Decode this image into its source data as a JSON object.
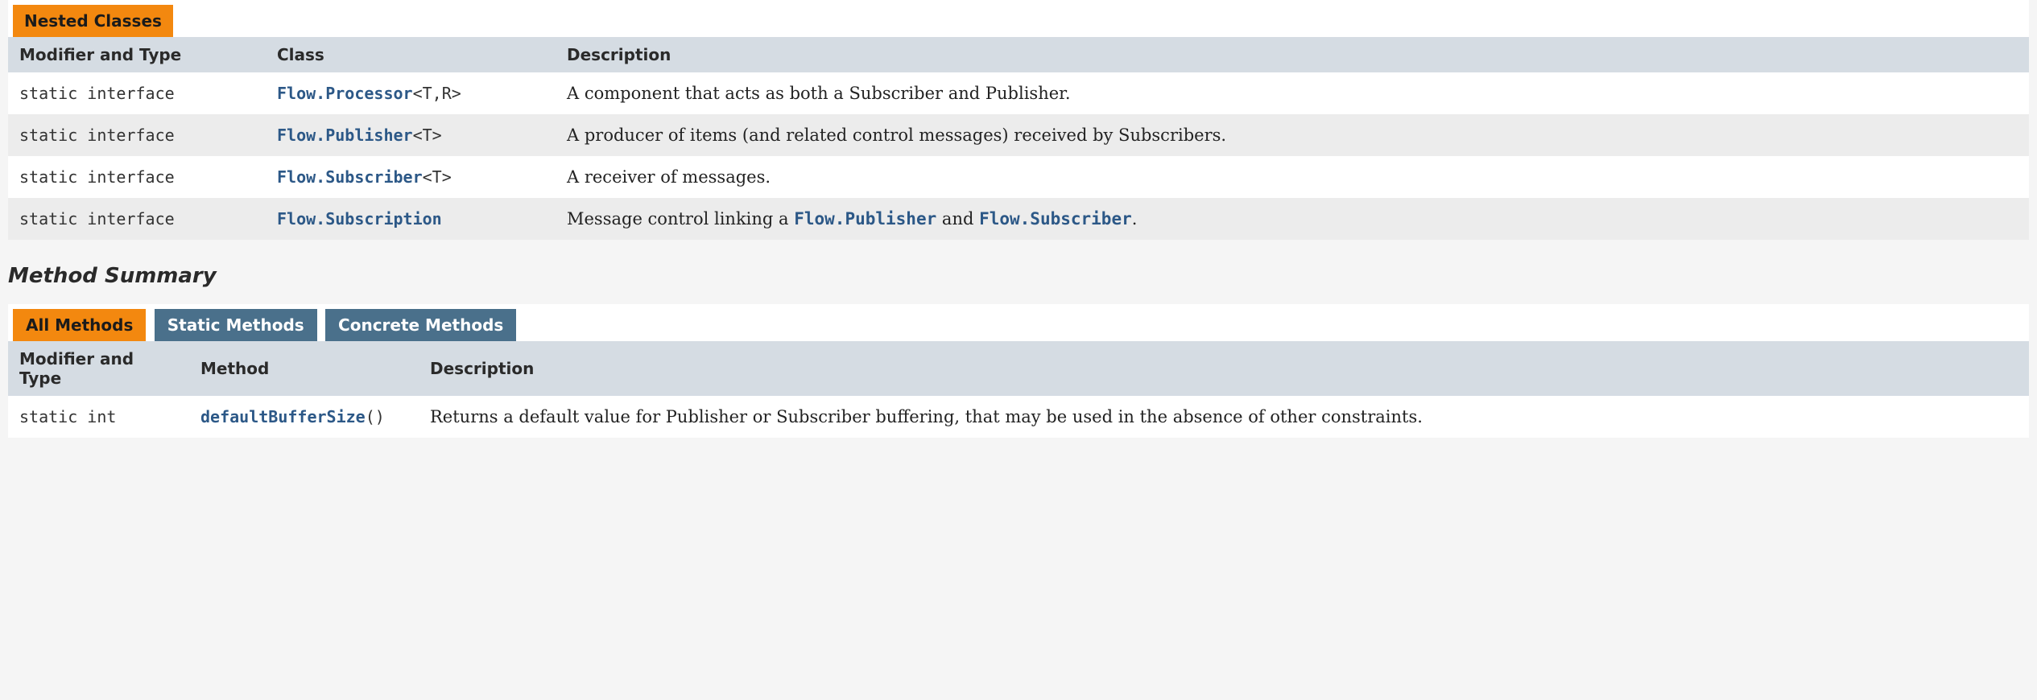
{
  "nested": {
    "caption": "Nested Classes",
    "headers": {
      "modifier": "Modifier and Type",
      "class": "Class",
      "description": "Description"
    },
    "rows": [
      {
        "modifier": "static interface ",
        "class_link": "Flow.Processor",
        "class_generic": "<T,R>",
        "desc_pre": "A component that acts as both a Subscriber and Publisher.",
        "desc_ref1": "",
        "desc_mid": "",
        "desc_ref2": "",
        "desc_post": ""
      },
      {
        "modifier": "static interface ",
        "class_link": "Flow.Publisher",
        "class_generic": "<T>",
        "desc_pre": "A producer of items (and related control messages) received by Subscribers.",
        "desc_ref1": "",
        "desc_mid": "",
        "desc_ref2": "",
        "desc_post": ""
      },
      {
        "modifier": "static interface ",
        "class_link": "Flow.Subscriber",
        "class_generic": "<T>",
        "desc_pre": "A receiver of messages.",
        "desc_ref1": "",
        "desc_mid": "",
        "desc_ref2": "",
        "desc_post": ""
      },
      {
        "modifier": "static interface ",
        "class_link": "Flow.Subscription",
        "class_generic": "",
        "desc_pre": "Message control linking a ",
        "desc_ref1": "Flow.Publisher",
        "desc_mid": " and ",
        "desc_ref2": "Flow.Subscriber",
        "desc_post": "."
      }
    ]
  },
  "methods": {
    "title": "Method Summary",
    "tabs": {
      "all": "All Methods",
      "static": "Static Methods",
      "concrete": "Concrete Methods"
    },
    "headers": {
      "modifier": "Modifier and Type",
      "method": "Method",
      "description": "Description"
    },
    "rows": [
      {
        "modifier": "static int",
        "method_link": "defaultBufferSize",
        "method_args": "()",
        "desc": "Returns a default value for Publisher or Subscriber buffering, that may be used in the absence of other constraints."
      }
    ]
  }
}
